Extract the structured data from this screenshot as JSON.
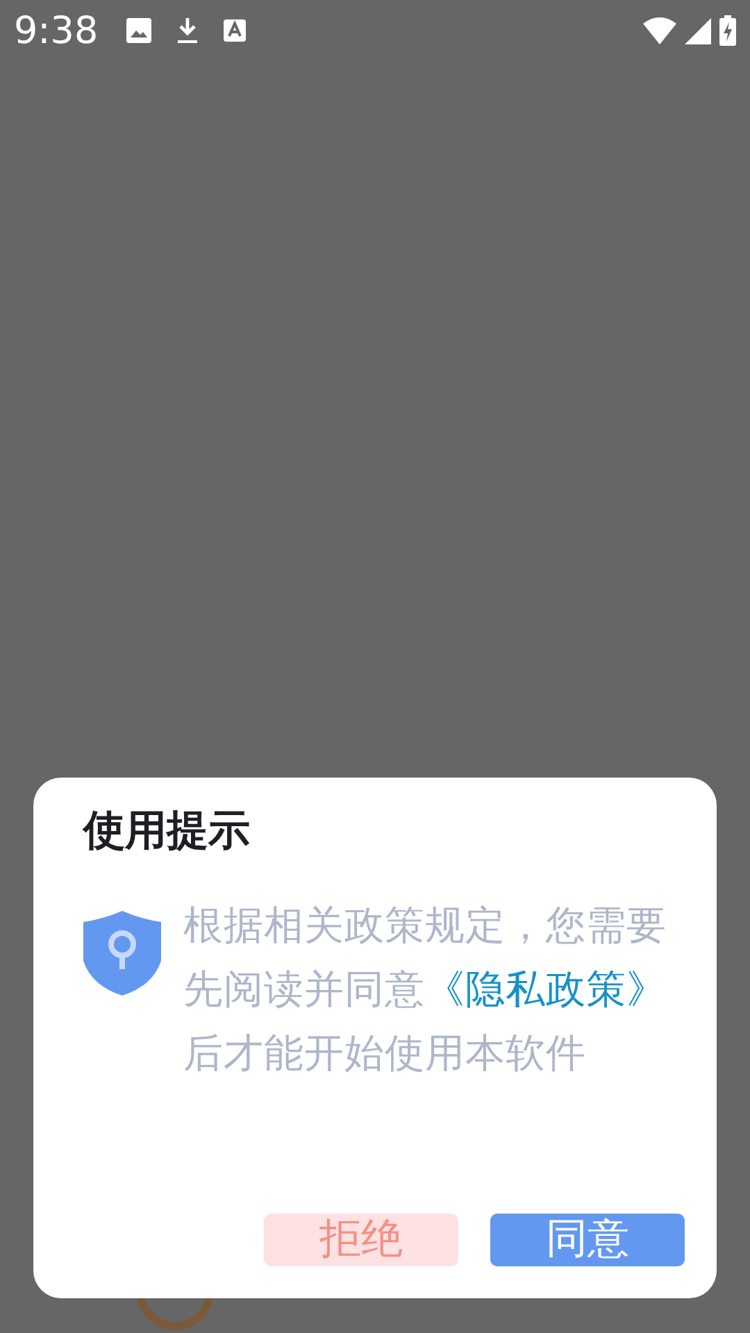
{
  "status_bar": {
    "time": "9:38"
  },
  "dialog": {
    "title": "使用提示",
    "message": {
      "before": "根据相关政策规定，您需要先阅读并同意",
      "link": "《隐私政策》",
      "after": "后才能开始使用本软件"
    },
    "buttons": [
      {
        "label": "拒绝",
        "kind": "reject"
      },
      {
        "label": "同意",
        "kind": "accept"
      }
    ]
  }
}
